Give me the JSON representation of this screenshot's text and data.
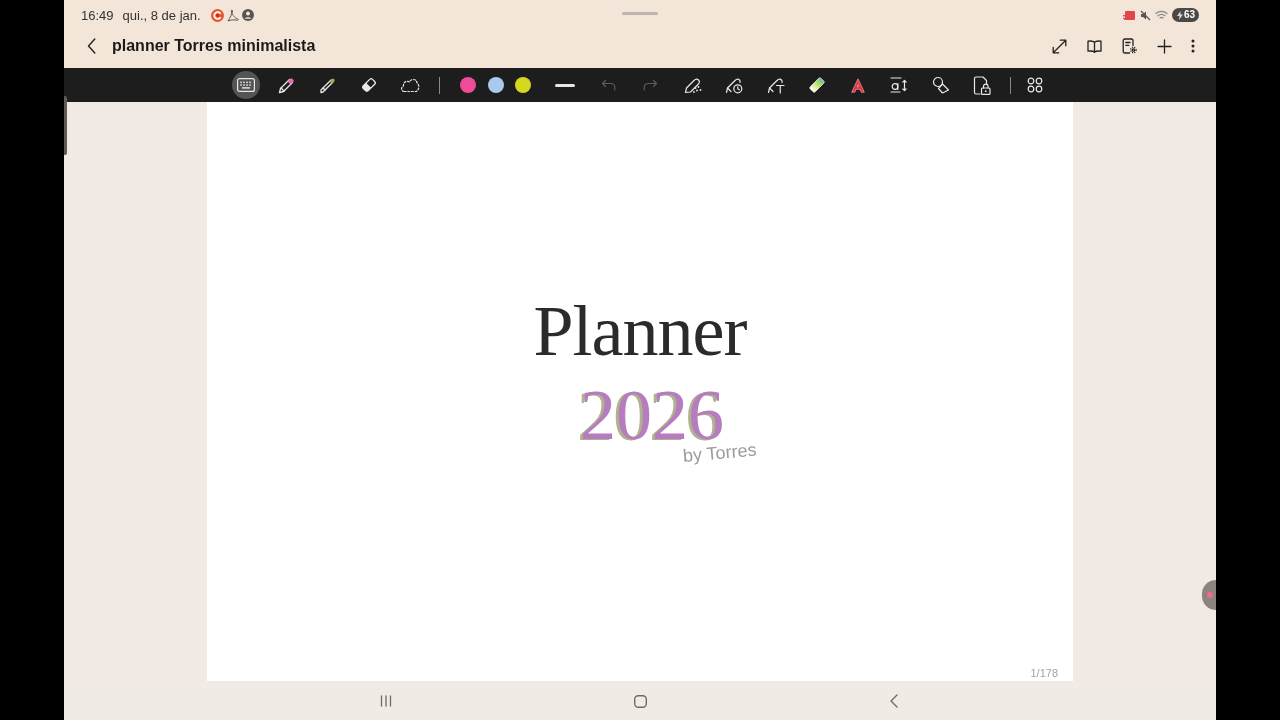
{
  "status_bar": {
    "time": "16:49",
    "date": "qui., 8 de jan.",
    "battery": "63"
  },
  "title_bar": {
    "title": "planner Torres minimalista"
  },
  "toolbar": {
    "tools": [
      {
        "kind": "keyboard",
        "selected": true
      },
      {
        "kind": "pen",
        "selected": false
      },
      {
        "kind": "highlighter",
        "selected": false
      },
      {
        "kind": "eraser",
        "selected": false
      },
      {
        "kind": "lasso",
        "selected": false
      }
    ],
    "colors": [
      {
        "color": "#ee4b98",
        "selected": false
      },
      {
        "color": "#a9c9ef",
        "selected": false
      },
      {
        "color": "#d6d81d",
        "selected": false
      }
    ],
    "history": [
      {
        "kind": "undo",
        "disabled": true
      },
      {
        "kind": "redo",
        "disabled": true
      }
    ]
  },
  "page": {
    "title": "Planner",
    "year": "2026",
    "byline": "by Torres",
    "page_number": "1/178"
  }
}
